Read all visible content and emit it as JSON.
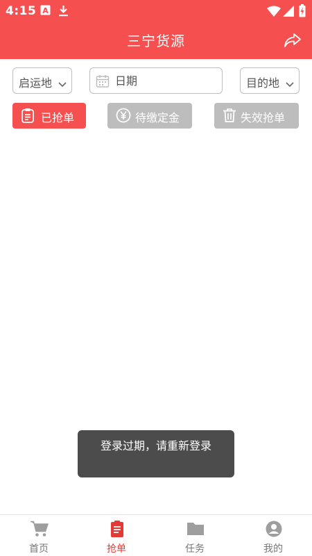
{
  "status_bar": {
    "time": "4:15",
    "icons": [
      "keyboard-a-icon",
      "download-icon",
      "wifi-icon",
      "signal-icon",
      "battery-icon"
    ]
  },
  "app_bar": {
    "title": "三宁货源",
    "action_icon": "share-icon"
  },
  "filters": {
    "origin_label": "启运地",
    "date_placeholder": "日期",
    "destination_label": "目的地"
  },
  "tabs": [
    {
      "label": "已抢单",
      "icon": "clipboard-icon",
      "active": true
    },
    {
      "label": "待缴定金",
      "icon": "yen-icon",
      "active": false
    },
    {
      "label": "失效抢单",
      "icon": "trash-icon",
      "active": false
    }
  ],
  "toast": {
    "message": "登录过期，请重新登录"
  },
  "bottom_nav": [
    {
      "label": "首页",
      "icon": "cart-icon",
      "active": false
    },
    {
      "label": "抢单",
      "icon": "clipboard-icon",
      "active": true
    },
    {
      "label": "任务",
      "icon": "folder-icon",
      "active": false
    },
    {
      "label": "我的",
      "icon": "account-icon",
      "active": false
    }
  ],
  "colors": {
    "brand_red": "#f5504f",
    "active_tab": "#f5504f",
    "inactive_tab": "#bdbdbd",
    "toast_bg": "#4c4c4c",
    "nav_active": "#e53935",
    "nav_inactive": "#777777"
  }
}
